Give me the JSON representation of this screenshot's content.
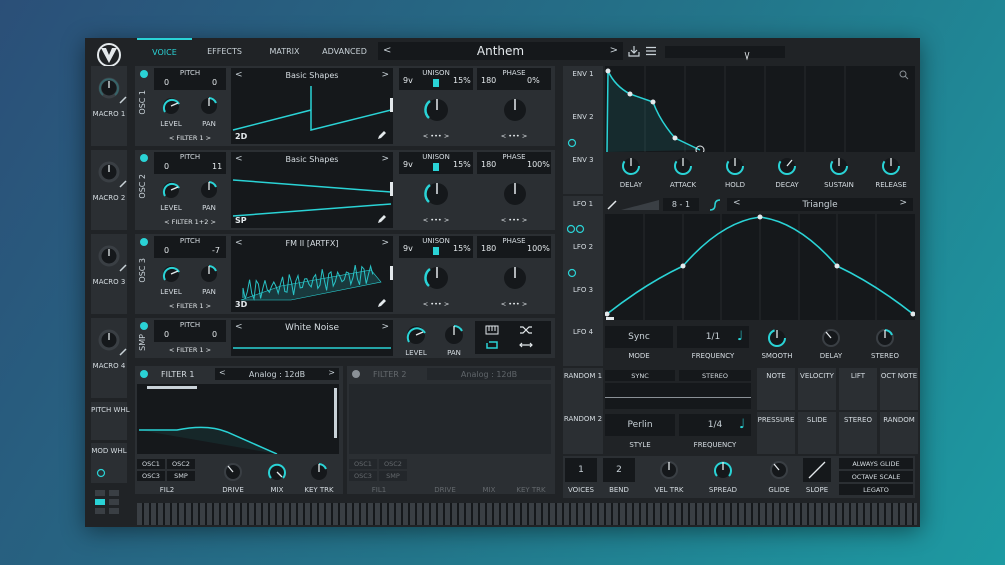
{
  "header": {
    "tabs": [
      "VOICE",
      "EFFECTS",
      "MATRIX",
      "ADVANCED"
    ],
    "active_tab": "VOICE",
    "preset_name": "Anthem"
  },
  "macros": [
    {
      "label": "MACRO 1"
    },
    {
      "label": "MACRO 2"
    },
    {
      "label": "MACRO 3"
    },
    {
      "label": "MACRO 4"
    }
  ],
  "wheels": {
    "pitch": "PITCH WHL",
    "mod": "MOD WHL"
  },
  "oscillators": [
    {
      "name": "OSC 1",
      "pitch_label": "PITCH",
      "pitch_a": "0",
      "pitch_b": "0",
      "level": "LEVEL",
      "pan": "PAN",
      "filter": "FILTER 1",
      "wavetable": "Basic Shapes",
      "dim": "2D",
      "unison_voices": "9v",
      "unison_label": "UNISON",
      "unison_detune": "15%",
      "phase_label": "PHASE",
      "phase_a": "180",
      "phase_b": "0%",
      "dots": "•••"
    },
    {
      "name": "OSC 2",
      "pitch_label": "PITCH",
      "pitch_a": "0",
      "pitch_b": "11",
      "level": "LEVEL",
      "pan": "PAN",
      "filter": "FILTER 1+2",
      "wavetable": "Basic Shapes",
      "dim": "SP",
      "unison_voices": "9v",
      "unison_label": "UNISON",
      "unison_detune": "15%",
      "phase_label": "PHASE",
      "phase_a": "180",
      "phase_b": "100%",
      "dots": "•••"
    },
    {
      "name": "OSC 3",
      "pitch_label": "PITCH",
      "pitch_a": "0",
      "pitch_b": "-7",
      "level": "LEVEL",
      "pan": "PAN",
      "filter": "FILTER 1",
      "wavetable": "FM II [ARTFX]",
      "dim": "3D",
      "unison_voices": "9v",
      "unison_label": "UNISON",
      "unison_detune": "15%",
      "phase_label": "PHASE",
      "phase_a": "180",
      "phase_b": "100%",
      "dots": "•••"
    }
  ],
  "sampler": {
    "name": "SMP",
    "pitch_label": "PITCH",
    "pitch_a": "0",
    "pitch_b": "0",
    "filter": "FILTER 1",
    "sample": "White Noise",
    "level": "LEVEL",
    "pan": "PAN"
  },
  "filter1": {
    "title": "FILTER 1",
    "model": "Analog : 12dB",
    "routes": [
      "OSC1",
      "OSC2",
      "OSC3",
      "SMP"
    ],
    "fil": "FIL2",
    "knobs": [
      "DRIVE",
      "MIX",
      "KEY TRK"
    ]
  },
  "filter2": {
    "title": "FILTER 2",
    "model": "Analog : 12dB",
    "routes": [
      "OSC1",
      "OSC2",
      "OSC3",
      "SMP"
    ],
    "fil": "FIL1",
    "knobs": [
      "DRIVE",
      "MIX",
      "KEY TRK"
    ]
  },
  "envelopes": {
    "tabs": [
      "ENV 1",
      "ENV 2",
      "ENV 3"
    ],
    "knobs": [
      "DELAY",
      "ATTACK",
      "HOLD",
      "DECAY",
      "SUSTAIN",
      "RELEASE"
    ]
  },
  "lfos": {
    "tabs": [
      "LFO 1",
      "LFO 2",
      "LFO 3",
      "LFO 4"
    ],
    "grid": "8 - 1",
    "shape": "Triangle",
    "mode_value": "Sync",
    "mode_label": "MODE",
    "freq_value": "1/1",
    "freq_label": "FREQUENCY",
    "knobs": [
      "SMOOTH",
      "DELAY",
      "STEREO"
    ]
  },
  "randoms": {
    "tabs": [
      "RANDOM 1",
      "RANDOM 2"
    ],
    "sync": "SYNC",
    "stereo": "STEREO",
    "style_value": "Perlin",
    "style_label": "STYLE",
    "freq_value": "1/4",
    "freq_label": "FREQUENCY"
  },
  "mod_sources": [
    "NOTE",
    "VELOCITY",
    "LIFT",
    "OCT NOTE",
    "PRESSURE",
    "SLIDE",
    "STEREO",
    "RANDOM"
  ],
  "voice": {
    "voices_value": "1",
    "voices_label": "VOICES",
    "bend_value": "2",
    "bend_label": "BEND",
    "knobs": [
      "VEL TRK",
      "SPREAD",
      "GLIDE",
      "SLOPE"
    ],
    "toggles": [
      "ALWAYS GLIDE",
      "OCTAVE SCALE",
      "LEGATO"
    ]
  },
  "colors": {
    "accent": "#2ad3d6",
    "panel": "#2b2f33",
    "background": "#202326",
    "well": "#15181b"
  }
}
